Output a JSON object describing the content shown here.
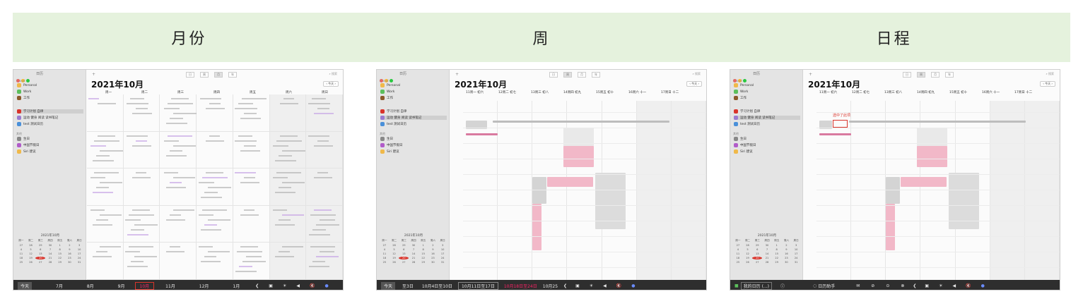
{
  "banner": {
    "month": "月份",
    "week": "周",
    "schedule": "日程"
  },
  "sidebar": {
    "title": "日历",
    "heading_icloud": "iCloud",
    "heading_other": "其他",
    "calendars": [
      {
        "label": "Personal",
        "color": "#f0b94a"
      },
      {
        "label": "Work",
        "color": "#5cbf5c"
      },
      {
        "label": "工作",
        "color": "#8b5a2b"
      },
      {
        "label": "学习计划 自律",
        "color": "#d9342b"
      },
      {
        "label": "运动 健身 阅读 读书笔记",
        "color": "#9b7bd0"
      },
      {
        "label": "test 测试日历",
        "color": "#4a90d9"
      },
      {
        "label": "生日",
        "color": "#888888"
      },
      {
        "label": "中国节假日",
        "color": "#b15cc9"
      },
      {
        "label": "Siri 建议",
        "color": "#f0b94a"
      }
    ],
    "mini_month": "2021年10月",
    "mini_weekdays": [
      "周一",
      "周二",
      "周三",
      "周四",
      "周五",
      "周六",
      "周日"
    ],
    "mini_days": [
      "27",
      "28",
      "29",
      "30",
      "1",
      "2",
      "3",
      "4",
      "5",
      "6",
      "7",
      "8",
      "9",
      "10",
      "11",
      "12",
      "13",
      "14",
      "15",
      "16",
      "17",
      "18",
      "19",
      "20",
      "21",
      "22",
      "23",
      "24",
      "25",
      "26",
      "27",
      "28",
      "29",
      "30",
      "31"
    ],
    "mini_today": "20"
  },
  "toolbar": {
    "day": "日",
    "week": "周",
    "month": "月",
    "year": "年",
    "search": "搜索",
    "today": "今天"
  },
  "title": "2021年10月",
  "month_weekdays": [
    "周一",
    "周二",
    "周三",
    "周四",
    "周五",
    "周六",
    "周日"
  ],
  "week_headers": [
    "11周一 初六",
    "12周二 初七",
    "13周三 初八",
    "14周四 初九",
    "15周五 初十",
    "16周六 十一",
    "17周日 十二"
  ],
  "schedule_tip": "选中了此项",
  "tabs_month": [
    "今天",
    "7月",
    "8月",
    "9月",
    "10月",
    "11月",
    "12月",
    "1月"
  ],
  "tabs_week": [
    "今天",
    "至3日",
    "10月4日至10日",
    "10月11日至17日",
    "10月18日至24日",
    "10月25"
  ],
  "tabs_schedule": [
    "我的日历 (...)",
    "日历助手"
  ],
  "colors": {
    "accent": "#d9342b",
    "banner": "#e5f2dd",
    "touchbar": "#2e2e2e",
    "event_pink": "#f2b8c8",
    "event_gray": "#c9c9c9"
  }
}
